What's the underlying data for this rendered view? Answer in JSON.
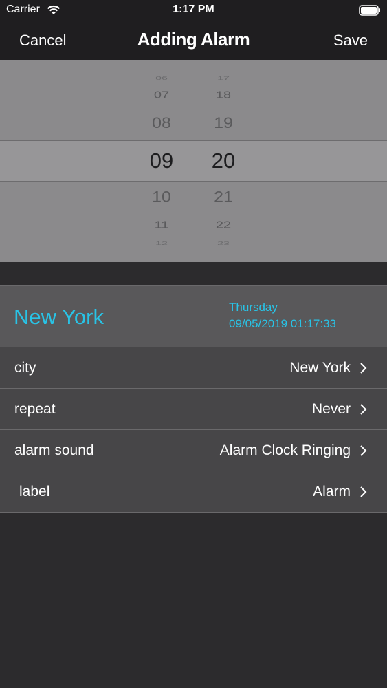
{
  "status_bar": {
    "carrier": "Carrier",
    "time": "1:17 PM",
    "icons": [
      "wifi-icon",
      "battery-icon"
    ]
  },
  "nav": {
    "cancel_label": "Cancel",
    "title": "Adding Alarm",
    "save_label": "Save"
  },
  "picker": {
    "hours": [
      "06",
      "07",
      "08",
      "09",
      "10",
      "11",
      "12"
    ],
    "minutes": [
      "17",
      "18",
      "19",
      "20",
      "21",
      "22",
      "23"
    ],
    "selected_hour": "09",
    "selected_minute": "20"
  },
  "city_header": {
    "city": "New York",
    "day": "Thursday",
    "datetime": "09/05/2019 01:17:33",
    "accent_color": "#29c3e6"
  },
  "settings": [
    {
      "label": "city",
      "value": "New York"
    },
    {
      "label": "repeat",
      "value": "Never"
    },
    {
      "label": "alarm sound",
      "value": "Alarm Clock Ringing"
    },
    {
      "label": "label",
      "value": "Alarm"
    }
  ],
  "icons": {
    "row_disclosure": "chevron-right-icon"
  }
}
